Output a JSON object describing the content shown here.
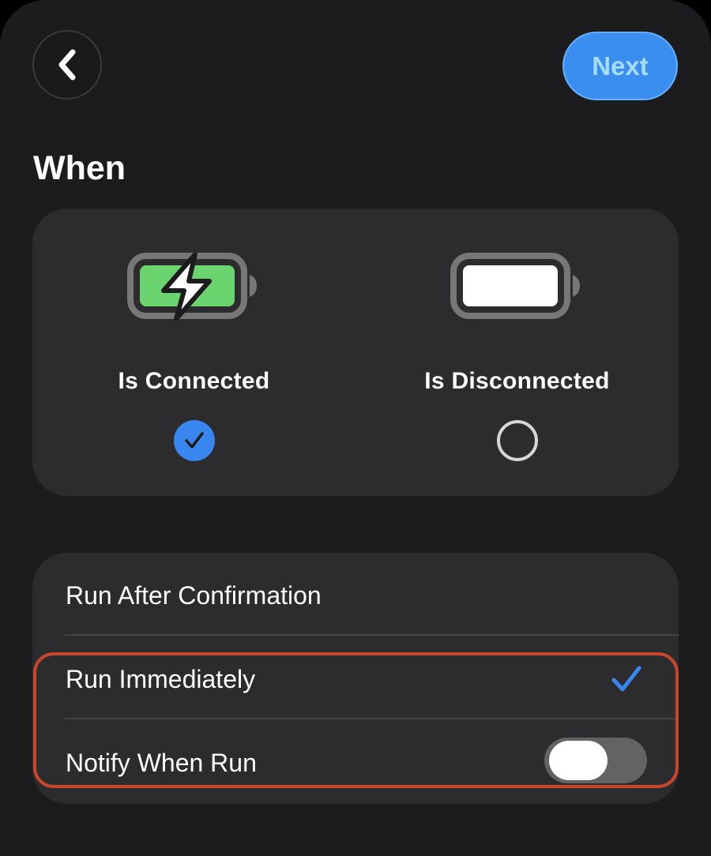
{
  "header": {
    "next_label": "Next"
  },
  "section": {
    "title": "When"
  },
  "trigger_options": [
    {
      "label": "Is Connected",
      "selected": true,
      "icon": "battery-charging-icon"
    },
    {
      "label": "Is Disconnected",
      "selected": false,
      "icon": "battery-full-icon"
    }
  ],
  "settings": {
    "rows": [
      {
        "label": "Run After Confirmation",
        "selected": false
      },
      {
        "label": "Run Immediately",
        "selected": true
      },
      {
        "label": "Notify When Run",
        "toggle_on": false
      }
    ]
  },
  "colors": {
    "accent": "#3a86f0",
    "battery_green": "#6cd46e",
    "highlight": "#c9462c"
  }
}
